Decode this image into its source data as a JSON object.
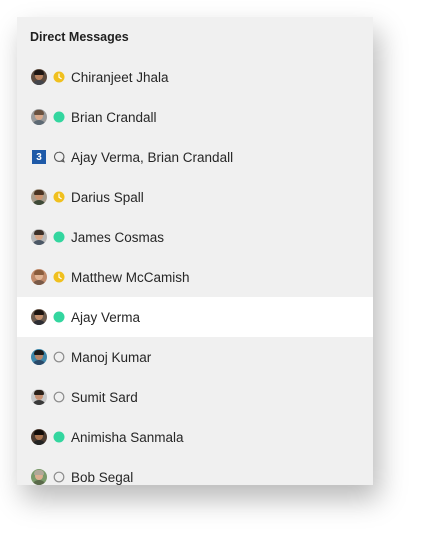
{
  "header": {
    "title": "Direct Messages"
  },
  "colors": {
    "available": "#33d69f",
    "away": "#f0c01e",
    "offline": "#8c8c8c",
    "group_badge": "#1e5aa8",
    "selected_row": "#ffffff",
    "panel": "#f0f0f0"
  },
  "conversations": [
    {
      "name": "Chiranjeet Jhala",
      "status": "away",
      "avatar": "avatar"
    },
    {
      "name": "Brian Crandall",
      "status": "available",
      "avatar": "avatar"
    },
    {
      "name": "Ajay Verma, Brian Crandall",
      "status": "group-chat-icon",
      "avatar": "group-badge",
      "badge": "3"
    },
    {
      "name": "Darius Spall",
      "status": "away",
      "avatar": "avatar"
    },
    {
      "name": "James Cosmas",
      "status": "available",
      "avatar": "avatar"
    },
    {
      "name": "Matthew McCamish",
      "status": "away",
      "avatar": "avatar"
    },
    {
      "name": "Ajay Verma",
      "status": "available",
      "avatar": "avatar",
      "selected": true
    },
    {
      "name": "Manoj Kumar",
      "status": "offline",
      "avatar": "avatar"
    },
    {
      "name": "Sumit Sard",
      "status": "offline",
      "avatar": "avatar"
    },
    {
      "name": "Animisha Sanmala",
      "status": "available",
      "avatar": "avatar"
    },
    {
      "name": "Bob Segal",
      "status": "offline",
      "avatar": "avatar"
    }
  ]
}
